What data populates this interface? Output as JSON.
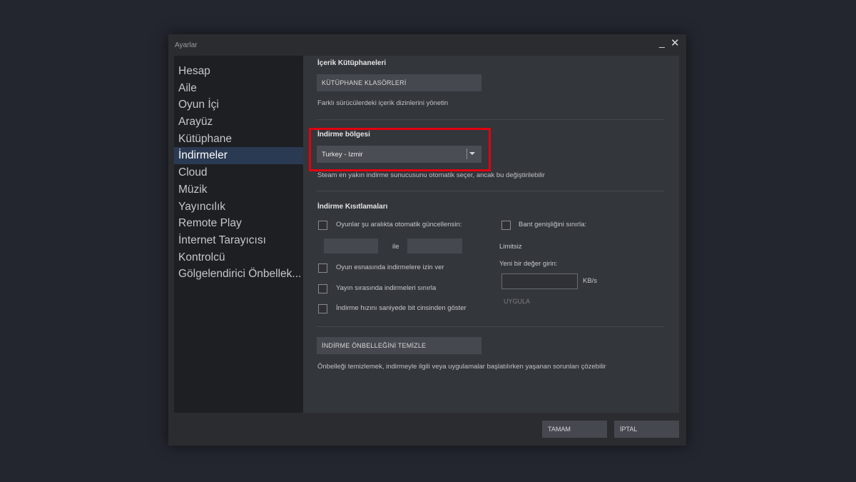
{
  "window": {
    "title": "Ayarlar",
    "minimize_glyph": "_",
    "close_glyph": "✕"
  },
  "sidebar": {
    "items": [
      {
        "label": "Hesap"
      },
      {
        "label": "Aile"
      },
      {
        "label": "Oyun İçi"
      },
      {
        "label": "Arayüz"
      },
      {
        "label": "Kütüphane"
      },
      {
        "label": "İndirmeler"
      },
      {
        "label": "Cloud"
      },
      {
        "label": "Müzik"
      },
      {
        "label": "Yayıncılık"
      },
      {
        "label": "Remote Play"
      },
      {
        "label": "İnternet Tarayıcısı"
      },
      {
        "label": "Kontrolcü"
      },
      {
        "label": "Gölgelendirici Önbellek..."
      }
    ],
    "active_index": 5
  },
  "content_libraries": {
    "heading": "İçerik Kütüphaneleri",
    "button": "KÜTÜPHANE KLASÖRLERİ",
    "description": "Farklı sürücülerdeki içerik dizinlerini yönetin"
  },
  "download_region": {
    "heading": "İndirme bölgesi",
    "selected": "Turkey - Izmir",
    "description": "Steam en yakın indirme sunucusunu otomatik seçer, ancak bu değiştirilebilir",
    "highlight_color": "#e3000f"
  },
  "download_restrictions": {
    "heading": "İndirme Kısıtlamaları",
    "auto_update_label": "Oyunlar şu aralıkta otomatik güncellensin:",
    "between_label": "ile",
    "allow_during_game_label": "Oyun esnasında indirmelere izin ver",
    "limit_while_streaming_label": "Yayın sırasında indirmeleri sınırla",
    "show_bits_label": "İndirme hızını saniyede bit cinsinden göster",
    "bandwidth_label": "Bant genişliğini sınırla:",
    "bandwidth_value": "Limitsiz",
    "new_value_label": "Yeni bir değer girin:",
    "unit": "KB/s",
    "apply_button": "UYGULA"
  },
  "cache": {
    "button": "İNDİRME ÖNBELLEĞİNİ TEMİZLE",
    "description": "Önbelleği temizlemek, indirmeyle ilgili veya uygulamalar başlatılırken yaşanan sorunları çözebilir"
  },
  "footer": {
    "ok": "TAMAM",
    "cancel": "İPTAL"
  }
}
